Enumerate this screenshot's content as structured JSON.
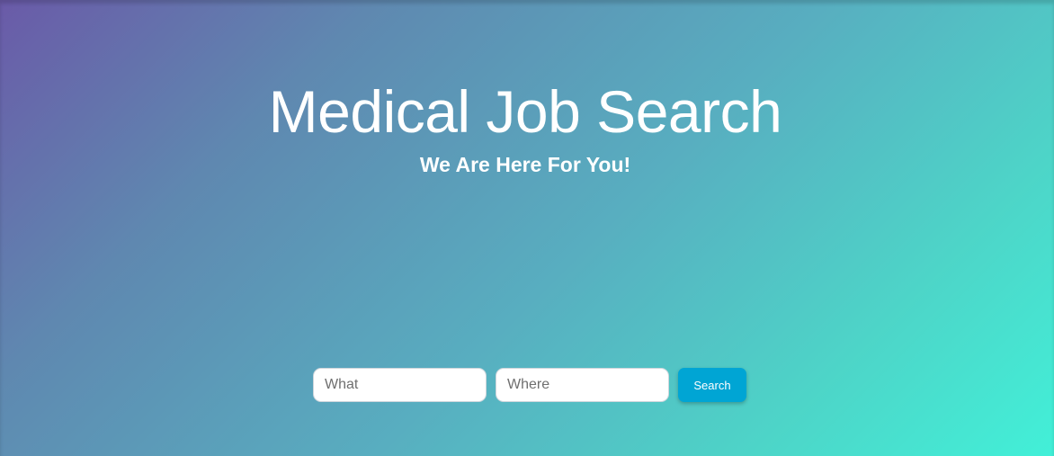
{
  "hero": {
    "title": "Medical Job Search",
    "subtitle": "We Are Here For You!"
  },
  "search": {
    "what_placeholder": "What",
    "what_value": "",
    "where_placeholder": "Where",
    "where_value": "",
    "button_label": "Search"
  },
  "colors": {
    "gradient_start": "#6a5aa8",
    "gradient_mid": "#58aec0",
    "gradient_end": "#42f0d8",
    "button": "#00a5d4",
    "text": "#ffffff"
  }
}
